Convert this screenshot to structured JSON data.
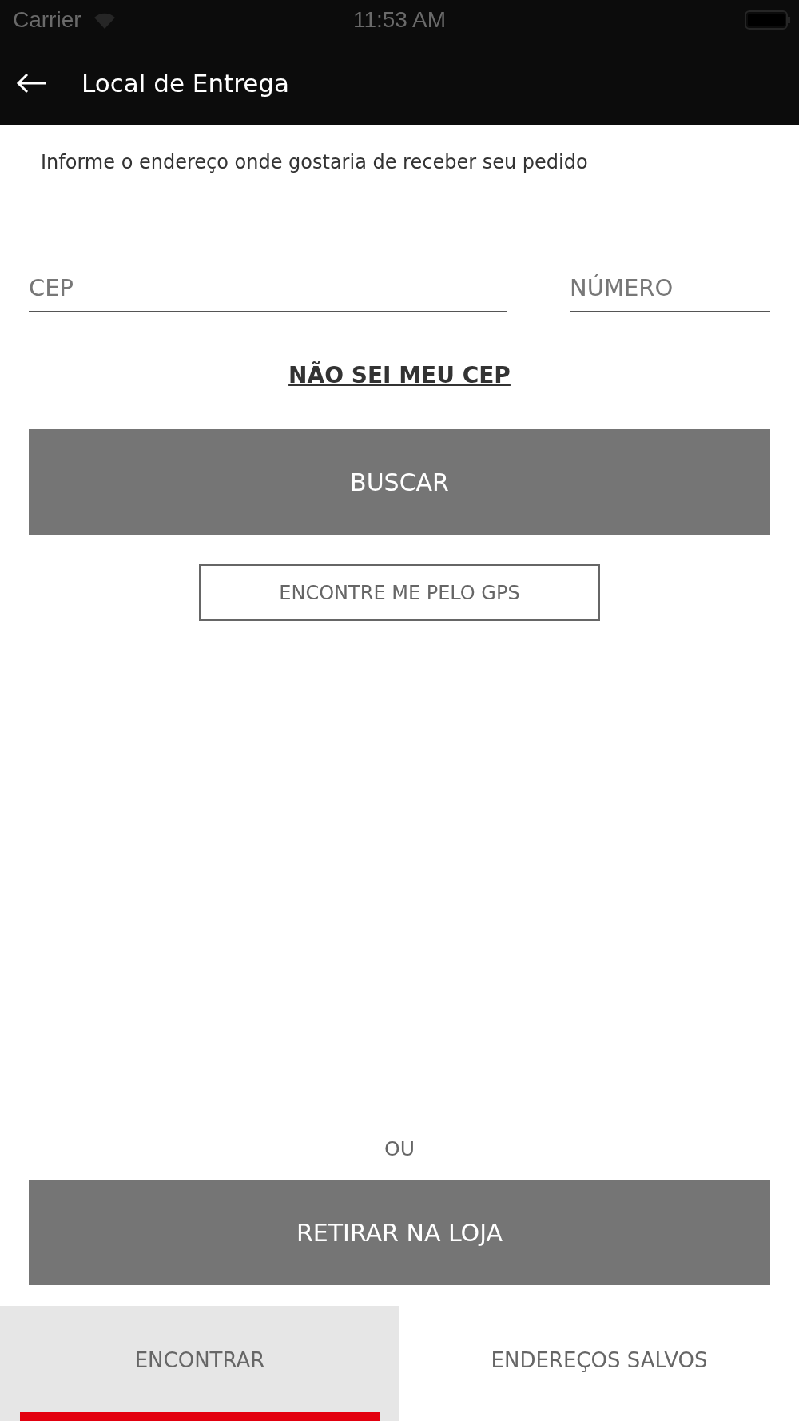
{
  "status_bar": {
    "carrier": "Carrier",
    "time": "11:53 AM"
  },
  "header": {
    "title": "Local de Entrega"
  },
  "intro": "Informe o endereço onde gostaria de receber seu pedido",
  "fields": [
    {
      "placeholder": "CEP"
    },
    {
      "placeholder": "NÚMERO"
    }
  ],
  "link": "NÃO SEI MEU CEP",
  "search_button": "BUSCAR",
  "gps_button": "ENCONTRE ME PELO GPS",
  "separator": "OU",
  "pickup_button": "RETIRAR NA LOJA",
  "tabs": [
    {
      "label": "ENCONTRAR",
      "selected": true
    },
    {
      "label": "ENDEREÇOS SALVOS",
      "selected": false
    }
  ]
}
